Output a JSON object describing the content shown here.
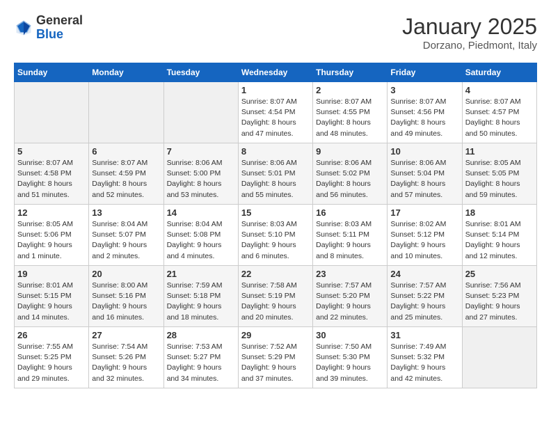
{
  "header": {
    "logo_general": "General",
    "logo_blue": "Blue",
    "calendar_title": "January 2025",
    "calendar_subtitle": "Dorzano, Piedmont, Italy"
  },
  "weekdays": [
    "Sunday",
    "Monday",
    "Tuesday",
    "Wednesday",
    "Thursday",
    "Friday",
    "Saturday"
  ],
  "weeks": [
    [
      {
        "day": "",
        "info": ""
      },
      {
        "day": "",
        "info": ""
      },
      {
        "day": "",
        "info": ""
      },
      {
        "day": "1",
        "info": "Sunrise: 8:07 AM\nSunset: 4:54 PM\nDaylight: 8 hours\nand 47 minutes."
      },
      {
        "day": "2",
        "info": "Sunrise: 8:07 AM\nSunset: 4:55 PM\nDaylight: 8 hours\nand 48 minutes."
      },
      {
        "day": "3",
        "info": "Sunrise: 8:07 AM\nSunset: 4:56 PM\nDaylight: 8 hours\nand 49 minutes."
      },
      {
        "day": "4",
        "info": "Sunrise: 8:07 AM\nSunset: 4:57 PM\nDaylight: 8 hours\nand 50 minutes."
      }
    ],
    [
      {
        "day": "5",
        "info": "Sunrise: 8:07 AM\nSunset: 4:58 PM\nDaylight: 8 hours\nand 51 minutes."
      },
      {
        "day": "6",
        "info": "Sunrise: 8:07 AM\nSunset: 4:59 PM\nDaylight: 8 hours\nand 52 minutes."
      },
      {
        "day": "7",
        "info": "Sunrise: 8:06 AM\nSunset: 5:00 PM\nDaylight: 8 hours\nand 53 minutes."
      },
      {
        "day": "8",
        "info": "Sunrise: 8:06 AM\nSunset: 5:01 PM\nDaylight: 8 hours\nand 55 minutes."
      },
      {
        "day": "9",
        "info": "Sunrise: 8:06 AM\nSunset: 5:02 PM\nDaylight: 8 hours\nand 56 minutes."
      },
      {
        "day": "10",
        "info": "Sunrise: 8:06 AM\nSunset: 5:04 PM\nDaylight: 8 hours\nand 57 minutes."
      },
      {
        "day": "11",
        "info": "Sunrise: 8:05 AM\nSunset: 5:05 PM\nDaylight: 8 hours\nand 59 minutes."
      }
    ],
    [
      {
        "day": "12",
        "info": "Sunrise: 8:05 AM\nSunset: 5:06 PM\nDaylight: 9 hours\nand 1 minute."
      },
      {
        "day": "13",
        "info": "Sunrise: 8:04 AM\nSunset: 5:07 PM\nDaylight: 9 hours\nand 2 minutes."
      },
      {
        "day": "14",
        "info": "Sunrise: 8:04 AM\nSunset: 5:08 PM\nDaylight: 9 hours\nand 4 minutes."
      },
      {
        "day": "15",
        "info": "Sunrise: 8:03 AM\nSunset: 5:10 PM\nDaylight: 9 hours\nand 6 minutes."
      },
      {
        "day": "16",
        "info": "Sunrise: 8:03 AM\nSunset: 5:11 PM\nDaylight: 9 hours\nand 8 minutes."
      },
      {
        "day": "17",
        "info": "Sunrise: 8:02 AM\nSunset: 5:12 PM\nDaylight: 9 hours\nand 10 minutes."
      },
      {
        "day": "18",
        "info": "Sunrise: 8:01 AM\nSunset: 5:14 PM\nDaylight: 9 hours\nand 12 minutes."
      }
    ],
    [
      {
        "day": "19",
        "info": "Sunrise: 8:01 AM\nSunset: 5:15 PM\nDaylight: 9 hours\nand 14 minutes."
      },
      {
        "day": "20",
        "info": "Sunrise: 8:00 AM\nSunset: 5:16 PM\nDaylight: 9 hours\nand 16 minutes."
      },
      {
        "day": "21",
        "info": "Sunrise: 7:59 AM\nSunset: 5:18 PM\nDaylight: 9 hours\nand 18 minutes."
      },
      {
        "day": "22",
        "info": "Sunrise: 7:58 AM\nSunset: 5:19 PM\nDaylight: 9 hours\nand 20 minutes."
      },
      {
        "day": "23",
        "info": "Sunrise: 7:57 AM\nSunset: 5:20 PM\nDaylight: 9 hours\nand 22 minutes."
      },
      {
        "day": "24",
        "info": "Sunrise: 7:57 AM\nSunset: 5:22 PM\nDaylight: 9 hours\nand 25 minutes."
      },
      {
        "day": "25",
        "info": "Sunrise: 7:56 AM\nSunset: 5:23 PM\nDaylight: 9 hours\nand 27 minutes."
      }
    ],
    [
      {
        "day": "26",
        "info": "Sunrise: 7:55 AM\nSunset: 5:25 PM\nDaylight: 9 hours\nand 29 minutes."
      },
      {
        "day": "27",
        "info": "Sunrise: 7:54 AM\nSunset: 5:26 PM\nDaylight: 9 hours\nand 32 minutes."
      },
      {
        "day": "28",
        "info": "Sunrise: 7:53 AM\nSunset: 5:27 PM\nDaylight: 9 hours\nand 34 minutes."
      },
      {
        "day": "29",
        "info": "Sunrise: 7:52 AM\nSunset: 5:29 PM\nDaylight: 9 hours\nand 37 minutes."
      },
      {
        "day": "30",
        "info": "Sunrise: 7:50 AM\nSunset: 5:30 PM\nDaylight: 9 hours\nand 39 minutes."
      },
      {
        "day": "31",
        "info": "Sunrise: 7:49 AM\nSunset: 5:32 PM\nDaylight: 9 hours\nand 42 minutes."
      },
      {
        "day": "",
        "info": ""
      }
    ]
  ]
}
